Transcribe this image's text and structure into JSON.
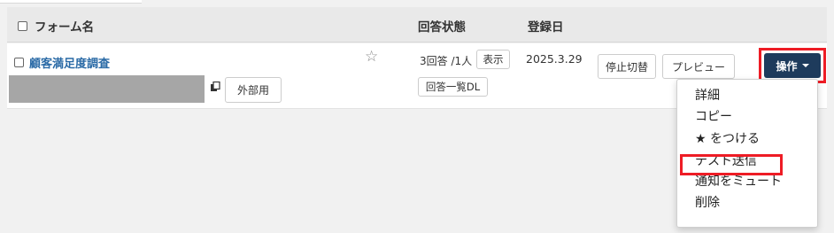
{
  "table": {
    "header": {
      "name": "フォーム名",
      "status": "回答状態",
      "registered": "登録日"
    },
    "rows": [
      {
        "form_name": "顧客満足度調査",
        "external_label": "外部用",
        "answers_text": "3回答 /1人",
        "show_label": "表示",
        "download_label": "回答一覧DL",
        "date": "2025.3.29",
        "stop_toggle_label": "停止切替",
        "preview_label": "プレビュー",
        "operation_label": "操作"
      }
    ]
  },
  "dropdown": {
    "items": [
      "詳細",
      "コピー",
      "★ をつける",
      "テスト送信",
      "通知をミュート",
      "削除"
    ],
    "highlighted_index": 3
  },
  "colors": {
    "link": "#2a6aa6",
    "operation_button": "#1e3b5c",
    "highlight_border": "#ee1c25"
  },
  "icons": {
    "favorite": "star-outline-icon",
    "copy": "copy-icon",
    "dropdown": "caret-down-icon"
  }
}
